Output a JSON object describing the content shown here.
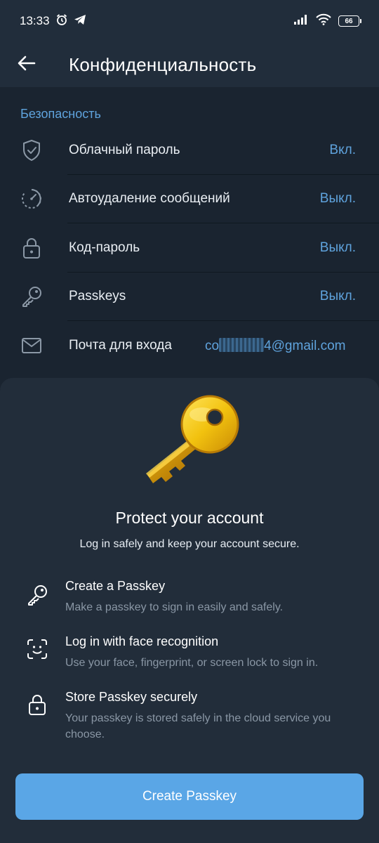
{
  "status_bar": {
    "time": "13:33",
    "battery": "66",
    "icons": [
      "alarm-icon",
      "telegram-icon",
      "signal-icon",
      "wifi-icon",
      "battery-icon"
    ]
  },
  "app_bar": {
    "title": "Конфиденциальность",
    "back_icon": "arrow-left-icon"
  },
  "security": {
    "section_title": "Безопасность",
    "rows": [
      {
        "icon": "shield-icon",
        "label": "Облачный пароль",
        "value": "Вкл."
      },
      {
        "icon": "timer-icon",
        "label": "Автоудаление сообщений",
        "value": "Выкл."
      },
      {
        "icon": "lock-icon",
        "label": "Код-пароль",
        "value": "Выкл."
      },
      {
        "icon": "key-icon",
        "label": "Passkeys",
        "value": "Выкл."
      },
      {
        "icon": "mail-icon",
        "label": "Почта для входа",
        "value_prefix": "co",
        "value_suffix": "4@gmail.com"
      }
    ]
  },
  "sheet": {
    "title": "Protect your account",
    "subtitle": "Log in safely and keep your account secure.",
    "features": [
      {
        "icon": "key-icon",
        "title": "Create a Passkey",
        "description": "Make a passkey to sign in easily and safely."
      },
      {
        "icon": "face-scan-icon",
        "title": "Log in with face recognition",
        "description": "Use your face, fingerprint, or screen lock to sign in."
      },
      {
        "icon": "lock-icon",
        "title": "Store Passkey securely",
        "description": "Your passkey is stored safely in the cloud service you choose."
      }
    ],
    "button_label": "Create Passkey"
  },
  "colors": {
    "accent": "#5aa6e6",
    "link": "#5fa3dd",
    "background": "#1a2430",
    "sheet": "#222d3a",
    "key_gold": "#f2c20f"
  }
}
